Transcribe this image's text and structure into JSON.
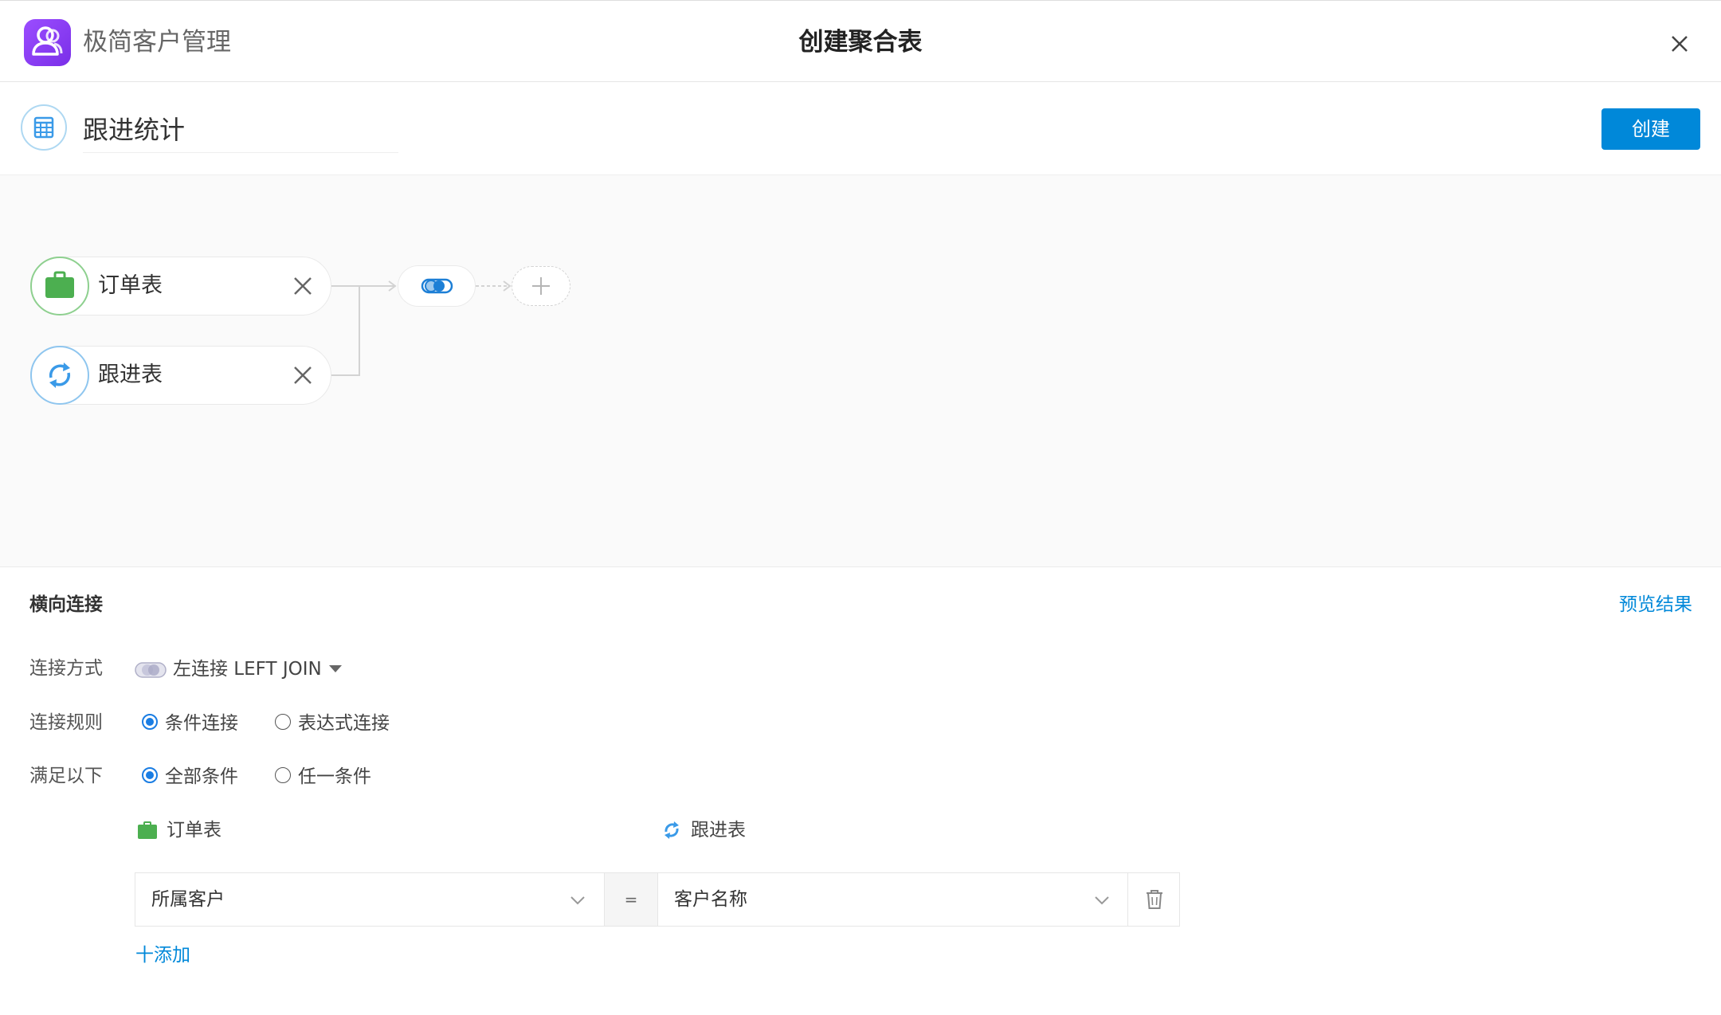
{
  "header": {
    "app_name": "极简客户管理",
    "dialog_title": "创建聚合表",
    "logo_color": "#8a3ff5"
  },
  "name_bar": {
    "table_name": "跟进统计",
    "create_label": "创建",
    "accent_color": "#0088d9"
  },
  "canvas": {
    "sources": [
      {
        "label": "订单表",
        "icon": "briefcase-icon",
        "color": "#4caf50"
      },
      {
        "label": "跟进表",
        "icon": "sync-icon",
        "color": "#3a9ae8"
      }
    ],
    "join_node_icon": "left-join-icon",
    "add_node_icon": "plus-icon"
  },
  "config": {
    "section_title": "横向连接",
    "preview_label": "预览结果",
    "join_type_label": "连接方式",
    "join_type_value": "左连接 LEFT JOIN",
    "join_rule_label": "连接规则",
    "join_rule_options": [
      "条件连接",
      "表达式连接"
    ],
    "join_rule_selected": "条件连接",
    "match_label": "满足以下",
    "match_options": [
      "全部条件",
      "任一条件"
    ],
    "match_selected": "全部条件",
    "left_table": "订单表",
    "right_table": "跟进表",
    "condition": {
      "left_field": "所属客户",
      "operator": "=",
      "right_field": "客户名称"
    },
    "add_label": "十添加"
  }
}
